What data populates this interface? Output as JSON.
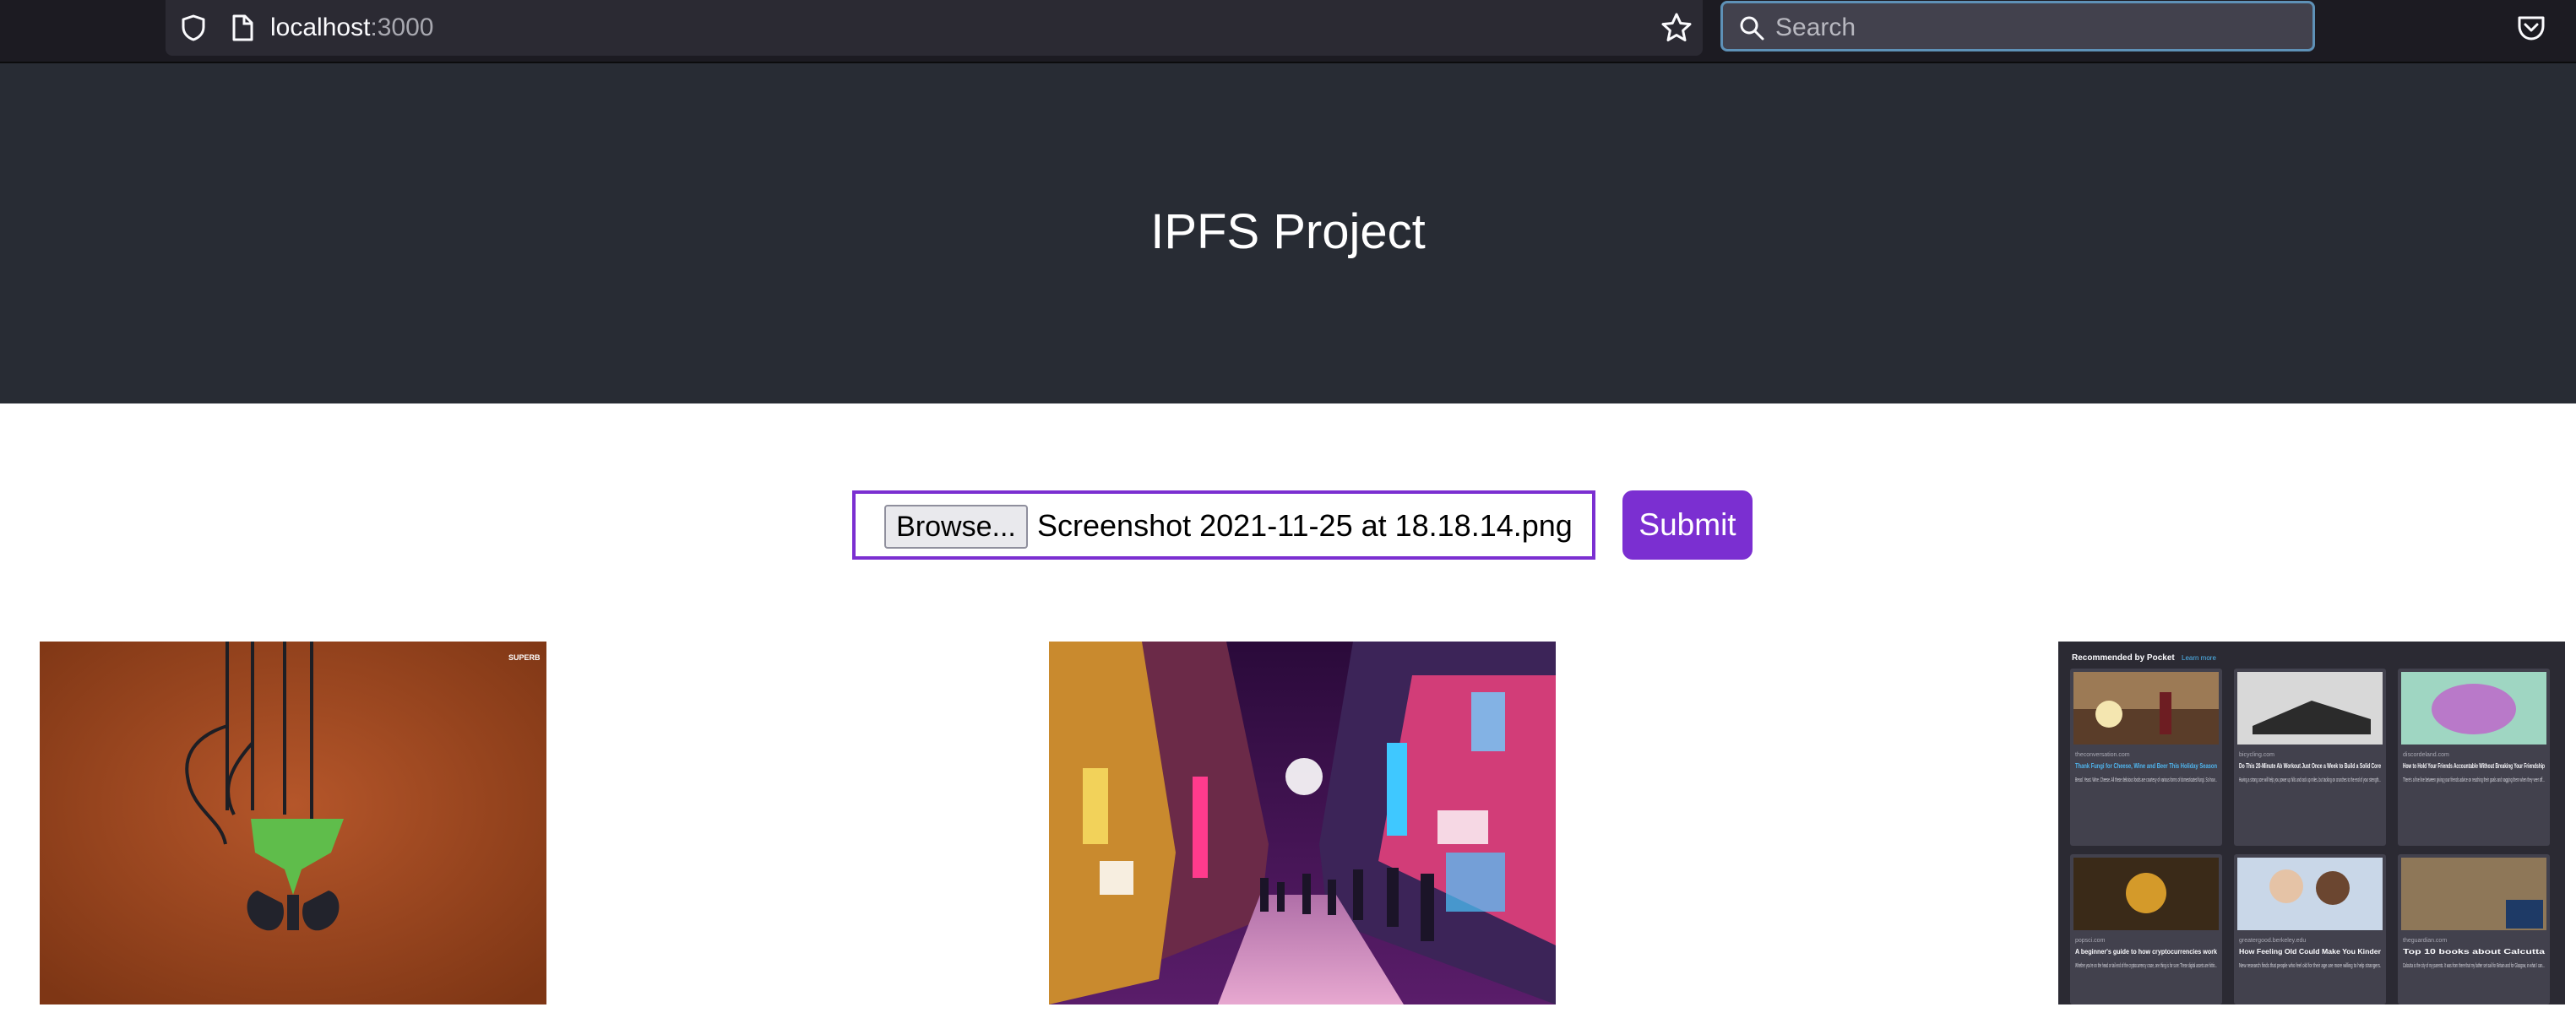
{
  "browser": {
    "url_host": "localhost",
    "url_port": ":3000",
    "search_placeholder": "Search",
    "icons": [
      "shield-icon",
      "page-icon",
      "star-icon",
      "search-icon",
      "pocket-icon"
    ]
  },
  "header": {
    "title": "IPFS Project",
    "background": "#282c34"
  },
  "upload": {
    "browse_label": "Browse...",
    "file_name": "Screenshot 2021-11-25 at 18.18.14.png",
    "submit_label": "Submit",
    "accent": "#7b2fd1"
  },
  "gallery": {
    "image1": {
      "watermark": "SUPERB"
    },
    "image2": {},
    "image3": {
      "header": "Recommended by Pocket",
      "learn_more": "Learn more",
      "cards": [
        {
          "source": "theconversation.com",
          "title": "Thank Fungi for Cheese, Wine and Beer This Holiday Season",
          "excerpt": "Bread. Yeast. Wine. Cheese. All these delicious foods are courtesy of various forms of domesticated fungi. So how..."
        },
        {
          "source": "bicycling.com",
          "title": "Do This 20-Minute Ab Workout Just Once a Week to Build a Solid Core",
          "excerpt": "Having a strong core will help you power up hills and rack up miles, but tacking on crunches to the end of your strength..."
        },
        {
          "source": "discordeland.com",
          "title": "How to Hold Your Friends Accountable Without Breaking Your Friendship",
          "excerpt": "There's a fine line between giving your friends advice on reaching their goals and nagging them when they veer off..."
        },
        {
          "source": "popsci.com",
          "title": "A beginner's guide to how cryptocurrencies work",
          "excerpt": "Whether you're on the head or tail end of the cryptocurrency craze, one thing is for sure: These digital assets are hittin..."
        },
        {
          "source": "greatergood.berkeley.edu",
          "title": "How Feeling Old Could Make You Kinder",
          "excerpt": "New research finds that people who feel old for their age are more willing to help strangers."
        },
        {
          "source": "theguardian.com",
          "title": "Top 10 books about Calcutta",
          "excerpt": "Calcutta is the city of my parents. It was from there that my father set sail for Britain and for Glasgow, in what I can..."
        }
      ]
    }
  }
}
